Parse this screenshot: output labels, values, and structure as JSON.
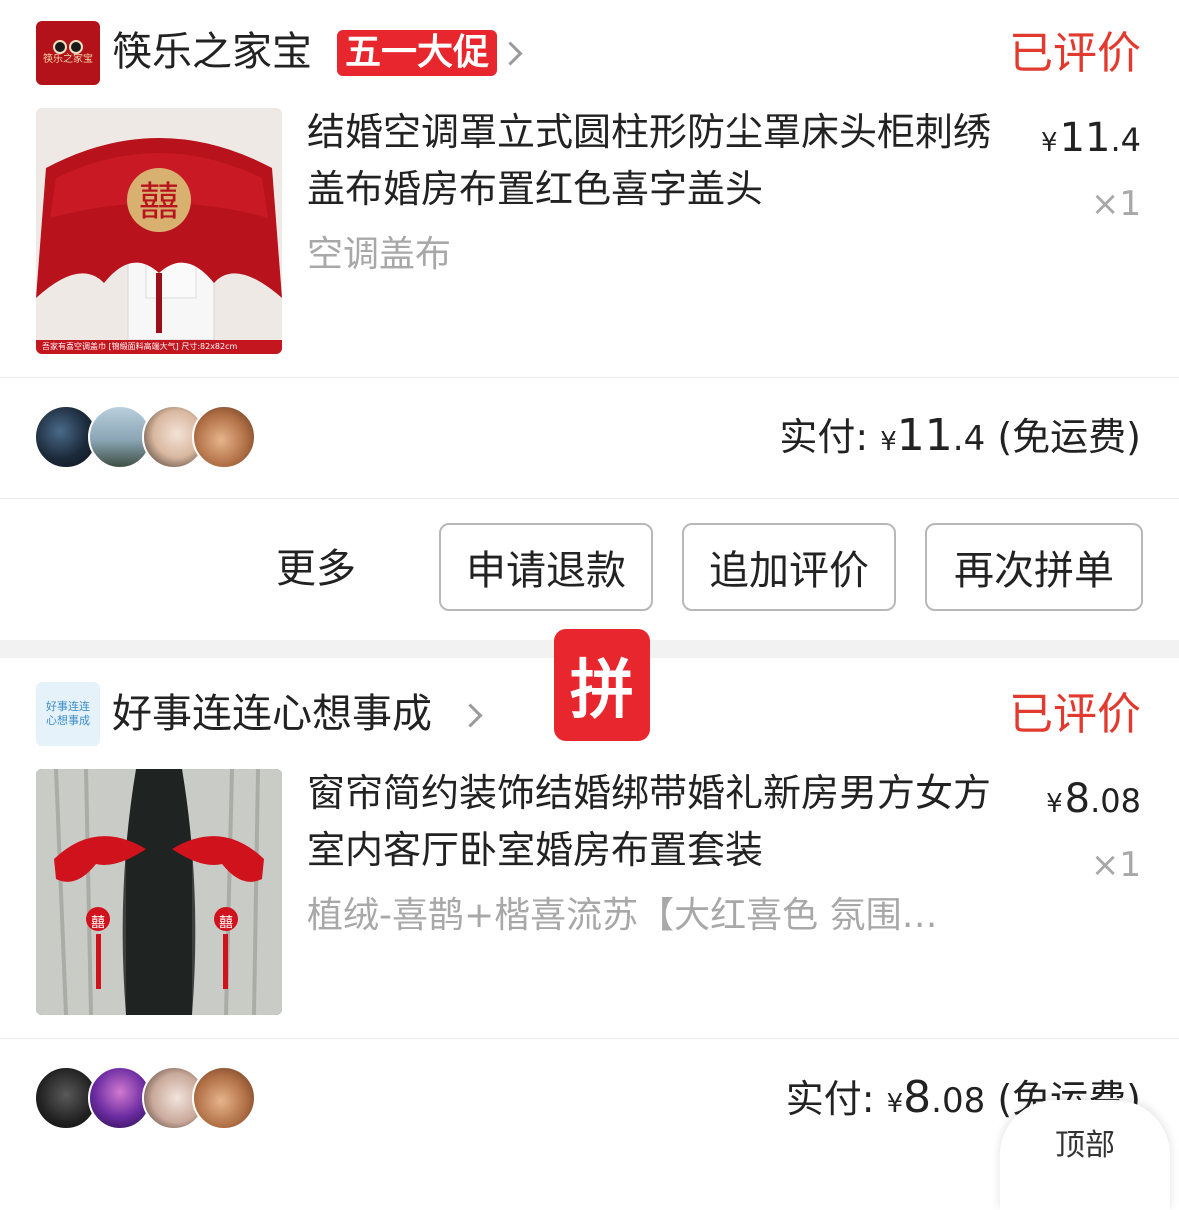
{
  "orders": [
    {
      "store_name": "筷乐之家宝",
      "store_logo_text": "筷乐之家宝",
      "promo_badge": "五一大促",
      "status": "已评价",
      "product_title": "结婚空调罩立式圆柱形防尘罩床头柜刺绣盖布婚房布置红色喜字盖头",
      "sku": "空调盖布",
      "thumb_caption": "吾家有喜空调盖巾 [锦缎面料高端大气] 尺寸:82x82cm",
      "thumb_symbol": "囍",
      "price_currency": "¥",
      "price_int": "11",
      "price_dec": ".4",
      "quantity": "×1",
      "paid_label": "实付:",
      "paid_currency": "¥",
      "paid_int": "11",
      "paid_dec": ".4",
      "paid_note": "(免运费)",
      "actions": {
        "more": "更多",
        "refund": "申请退款",
        "add_review": "追加评价",
        "rebuy": "再次拼单"
      }
    },
    {
      "store_name": "好事连连心想事成",
      "store_logo_text": "好事连连心想事成",
      "status": "已评价",
      "product_title": "窗帘简约装饰结婚绑带婚礼新房男方女方室内客厅卧室婚房布置套装",
      "sku": "植绒-喜鹊+楷喜流苏【大红喜色 氛围感满满】",
      "thumb_symbol": "囍",
      "price_currency": "¥",
      "price_int": "8",
      "price_dec": ".08",
      "quantity": "×1",
      "paid_label": "实付:",
      "paid_currency": "¥",
      "paid_int": "8",
      "paid_dec": ".08",
      "paid_note": "(免运费)"
    }
  ],
  "pin_badge": "拼",
  "back_to_top": "顶部",
  "colors": {
    "accent_red": "#e8262d",
    "status_red": "#e23a2e",
    "muted_gray": "#a8a8a8"
  },
  "icons": {
    "chevron": "chevron-right-icon"
  }
}
